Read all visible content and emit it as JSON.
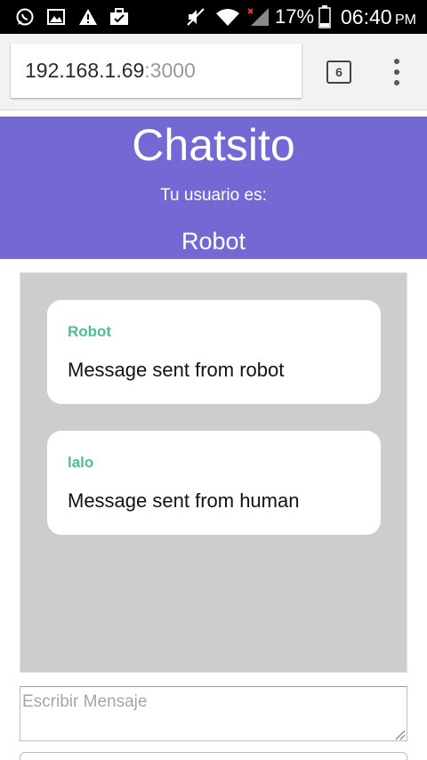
{
  "status_bar": {
    "icons": [
      "whatsapp-icon",
      "image-icon",
      "warning-icon",
      "briefcase-icon",
      "mute-icon",
      "wifi-icon",
      "signal-icon",
      "battery-icon"
    ],
    "battery_percent": "17%",
    "time": "06:40",
    "ampm": "PM"
  },
  "browser": {
    "url_host": "192.168.1.69",
    "url_port": ":3000",
    "tab_count": "6"
  },
  "header": {
    "title": "Chatsito",
    "user_caption": "Tu usuario es:",
    "user_name": "Robot",
    "background_color": "#7468d4"
  },
  "messages": [
    {
      "author": "Robot",
      "text": "Message sent from robot"
    },
    {
      "author": "lalo",
      "text": "Message sent from human"
    }
  ],
  "composer": {
    "placeholder": "Escribir Mensaje"
  },
  "colors": {
    "author_green": "#4cc08f",
    "messages_bg": "#cdcdcd"
  }
}
